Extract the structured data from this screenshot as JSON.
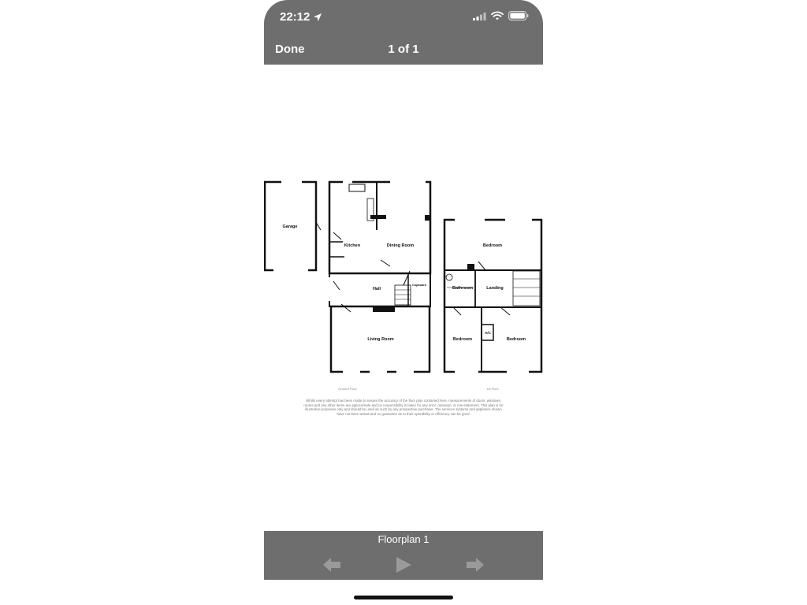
{
  "status": {
    "time": "22:12"
  },
  "nav": {
    "done_label": "Done",
    "page_count": "1 of 1"
  },
  "floorplan": {
    "ground": {
      "label": "Ground Floor",
      "rooms": {
        "garage": "Garage",
        "kitchen": "Kitchen",
        "dining": "Dining Room",
        "hall": "Hall",
        "cupboard": "Cupboard",
        "living": "Living Room"
      }
    },
    "first": {
      "label": "1st Floor",
      "rooms": {
        "bedroom_top": "Bedroom",
        "bathroom": "Bathroom",
        "landing": "Landing",
        "ac": "A/C",
        "bedroom_left": "Bedroom",
        "bedroom_right": "Bedroom"
      }
    },
    "disclaimer": "Whilst every attempt has been made to ensure the accuracy of the floor plan contained here, measurements of doors, windows, rooms and any other items are approximate and no responsibility is taken for any error, omission, or mis-statement. This plan is for illustrative purposes only and should be used as such by any prospective purchaser. The services systems and appliance shown have not been tested and no guarantee as to their operability or efficiency can be given"
  },
  "bottom": {
    "caption": "Floorplan 1"
  },
  "icons": {
    "location": "location-arrow-icon",
    "signal": "cellular-signal-icon",
    "wifi": "wifi-icon",
    "battery": "battery-icon",
    "prev": "arrow-left-icon",
    "play": "play-icon",
    "next": "arrow-right-icon"
  }
}
